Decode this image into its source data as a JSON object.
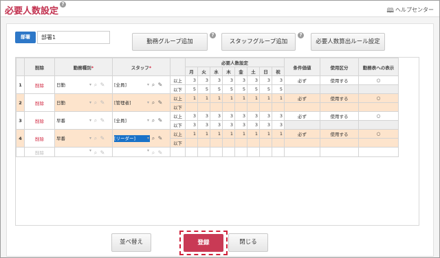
{
  "header": {
    "title": "必要人数設定",
    "help_center": "ヘルプセンター"
  },
  "dept": {
    "label": "部署",
    "value": "部署1"
  },
  "buttons": {
    "add_work_group": "勤務グループ追加",
    "add_staff_group": "スタッフグループ追加",
    "calc_rule": "必要人数算出ルール設定",
    "sort": "並べ替え",
    "register": "登録",
    "close": "閉じる"
  },
  "columns": {
    "delete": "削除",
    "work_type": "勤務種別",
    "staff": "スタッフ",
    "required": "必要人数設定",
    "condition": "条件価値",
    "usage": "使用区分",
    "display": "勤務表への表示"
  },
  "days": [
    "月",
    "火",
    "水",
    "木",
    "金",
    "土",
    "日",
    "祝"
  ],
  "rows": [
    {
      "num": "1",
      "delete": "削除",
      "work_type": "日勤",
      "staff": "[全員]",
      "lines": [
        {
          "label": "以上",
          "values": [
            "3",
            "3",
            "3",
            "3",
            "3",
            "3",
            "3",
            "3"
          ]
        },
        {
          "label": "以下",
          "values": [
            "5",
            "5",
            "5",
            "5",
            "5",
            "5",
            "5",
            "5"
          ]
        }
      ],
      "condition": "必ず",
      "usage": "使用する",
      "display": "○"
    },
    {
      "num": "2",
      "delete": "削除",
      "work_type": "日勤",
      "staff": "[管理者]",
      "lines": [
        {
          "label": "以上",
          "values": [
            "1",
            "1",
            "1",
            "1",
            "1",
            "1",
            "1",
            "1"
          ]
        },
        {
          "label": "以下",
          "values": [
            "",
            "",
            "",
            "",
            "",
            "",
            "",
            ""
          ]
        }
      ],
      "condition": "必ず",
      "usage": "使用する",
      "display": "○"
    },
    {
      "num": "3",
      "delete": "削除",
      "work_type": "早番",
      "staff": "[全員]",
      "lines": [
        {
          "label": "以上",
          "values": [
            "3",
            "3",
            "3",
            "3",
            "3",
            "3",
            "3",
            "3"
          ]
        },
        {
          "label": "以下",
          "values": [
            "3",
            "3",
            "3",
            "3",
            "3",
            "3",
            "3",
            "3"
          ]
        }
      ],
      "condition": "必ず",
      "usage": "使用する",
      "display": "○"
    },
    {
      "num": "4",
      "delete": "削除",
      "work_type": "早番",
      "staff": "[リーダー]",
      "lines": [
        {
          "label": "以上",
          "values": [
            "1",
            "1",
            "1",
            "1",
            "1",
            "1",
            "1",
            "1"
          ]
        },
        {
          "label": "以下",
          "values": [
            "",
            "",
            "",
            "",
            "",
            "",
            "",
            ""
          ]
        }
      ],
      "condition": "必ず",
      "usage": "使用する",
      "display": "○"
    }
  ],
  "empty_row": {
    "delete": "削除"
  },
  "colors": {
    "accent": "#c2314f",
    "row_highlight": "#fde4cc",
    "selected": "#1a72c8"
  }
}
